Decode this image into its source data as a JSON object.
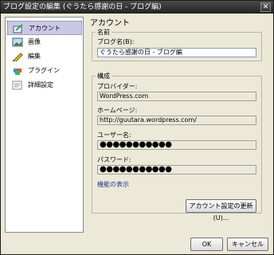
{
  "window": {
    "title": "ブログ設定の編集 (ぐうたら感謝の日 - ブログ編)",
    "close_glyph": "✕"
  },
  "sidebar": {
    "items": [
      {
        "label": "アカウント",
        "icon": "account-icon"
      },
      {
        "label": "画像",
        "icon": "image-icon"
      },
      {
        "label": "編集",
        "icon": "pencil-icon"
      },
      {
        "label": "プラグイン",
        "icon": "plugin-icon"
      },
      {
        "label": "詳細設定",
        "icon": "advanced-settings-icon"
      }
    ]
  },
  "panel": {
    "title": "アカウント",
    "name_group": {
      "legend": "名前",
      "blog_name_label": "ブログ名(B):",
      "blog_name_value": "ぐうたら感謝の日 - ブログ編"
    },
    "config_group": {
      "legend": "構成",
      "provider_label": "プロバイダー:",
      "provider_value": "WordPress.com",
      "homepage_label": "ホームページ:",
      "homepage_value": "http://guutara.wordpress.com/",
      "username_label": "ユーザー名:",
      "username_value": "●●●●●●●●●●●",
      "password_label": "パスワード:",
      "password_value": "●●●●●●●●●●●",
      "features_link": "機能の表示",
      "update_button": "アカウント設定の更新(U)..."
    }
  },
  "footer": {
    "ok": "OK",
    "cancel": "キャンセル"
  }
}
